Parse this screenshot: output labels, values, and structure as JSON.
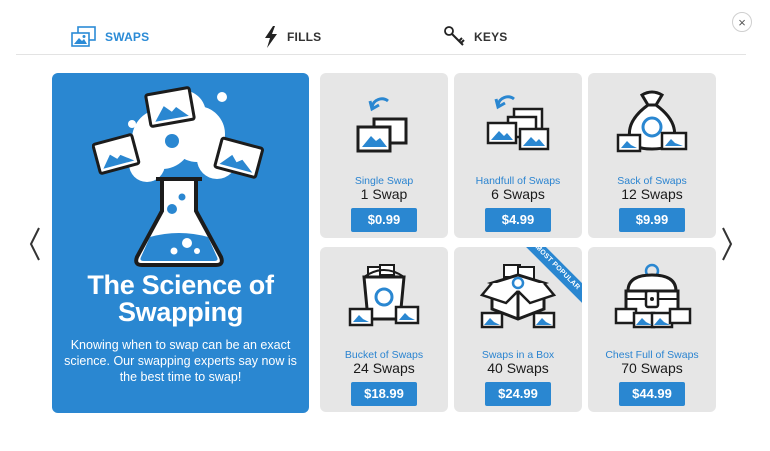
{
  "tabs": [
    {
      "label": "SWAPS",
      "icon": "photos-icon",
      "active": true
    },
    {
      "label": "FILLS",
      "icon": "lightning-icon",
      "active": false
    },
    {
      "label": "KEYS",
      "icon": "keys-icon",
      "active": false
    }
  ],
  "close_label": "×",
  "hero": {
    "title": "The Science of Swapping",
    "description": "Knowing when to swap can be an exact science. Our swapping experts say now is the best time to swap!"
  },
  "products": [
    {
      "name": "Single Swap",
      "count": "1 Swap",
      "price": "$0.99",
      "icon": "single-photo-swap-icon"
    },
    {
      "name": "Handfull of Swaps",
      "count": "6 Swaps",
      "price": "$4.99",
      "icon": "photo-stack-swap-icon"
    },
    {
      "name": "Sack of Swaps",
      "count": "12 Swaps",
      "price": "$9.99",
      "icon": "sack-icon"
    },
    {
      "name": "Bucket of Swaps",
      "count": "24 Swaps",
      "price": "$18.99",
      "icon": "bucket-icon"
    },
    {
      "name": "Swaps in a Box",
      "count": "40 Swaps",
      "price": "$24.99",
      "icon": "box-icon",
      "badge": "MOST POPULAR"
    },
    {
      "name": "Chest Full of Swaps",
      "count": "70 Swaps",
      "price": "$44.99",
      "icon": "treasure-chest-icon"
    }
  ],
  "colors": {
    "accent": "#2a87d1",
    "card_bg": "#e6e6e6",
    "link": "#2b84d0"
  }
}
